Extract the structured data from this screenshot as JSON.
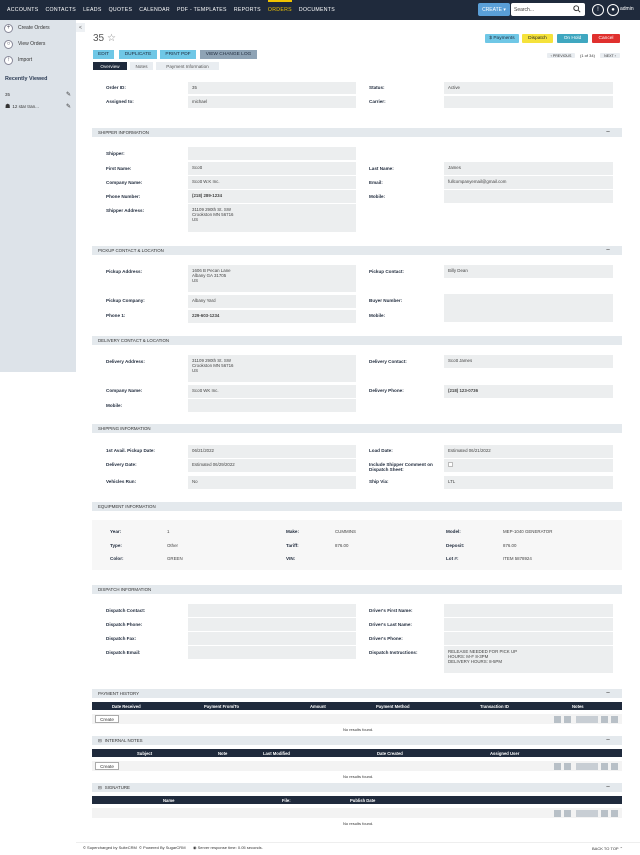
{
  "nav": {
    "items": [
      "ACCOUNTS",
      "CONTACTS",
      "LEADS",
      "QUOTES",
      "CALENDAR",
      "PDF - TEMPLATES",
      "REPORTS",
      "ORDERS",
      "DOCUMENTS"
    ],
    "create_label": "CREATE",
    "search_placeholder": "Search...",
    "user_label": "admin"
  },
  "sidebar": {
    "actions": [
      "Create Orders",
      "View Orders",
      "Import"
    ],
    "recently_viewed_title": "Recently Viewed",
    "recent_items": [
      "35",
      "12 star tran..."
    ]
  },
  "record": {
    "title": "35",
    "buttons": [
      "EDIT",
      "DUPLICATE",
      "PRINT PDF",
      "VIEW CHANGE LOG"
    ],
    "tabs": [
      "Overview",
      "Notes",
      "Payment Information"
    ],
    "status_buttons": [
      "$ Payments",
      "Dispatch",
      "On Hold",
      "Cancel"
    ],
    "pager": {
      "previous": "PREVIOUS",
      "count": "(1 of 34)",
      "next": "NEXT"
    }
  },
  "overview": {
    "order_id_label": "Order ID:",
    "order_id": "35",
    "status_label": "Status:",
    "status": "Active",
    "assigned_label": "Assigned to:",
    "assigned": "michael",
    "carrier_label": "Carrier:",
    "carrier": ""
  },
  "shipper": {
    "header": "SHIPPER INFORMATION",
    "shipper_label": "Shipper:",
    "first_name_label": "First Name:",
    "first_name": "Scott",
    "last_name_label": "Last Name:",
    "last_name": "James",
    "company_label": "Company Name:",
    "company": "Scott W.K Inc.",
    "email_label": "Email:",
    "email": "fullcompanyemail@gmail.com",
    "phone_label": "Phone Number:",
    "phone": "(218) 289-1234",
    "mobile_label": "Mobile:",
    "address_label": "Shipper Address:",
    "address": [
      "31109 290th St. SW",
      "Crookston MN  56716",
      "US"
    ]
  },
  "pickup": {
    "header": "PICKUP CONTACT & LOCATION",
    "address_label": "Pickup Address:",
    "address": [
      "1606 B Pecan Lane",
      "Albany GA  31705",
      "US"
    ],
    "contact_label": "Pickup Contact:",
    "contact": "Billy Dean",
    "company_label": "Pickup Company:",
    "company": "Albany Yard",
    "buyer_label": "Buyer Number:",
    "phone_label": "Phone 1:",
    "phone": "229-603-1234",
    "mobile_label": "Mobile:"
  },
  "delivery": {
    "header": "DELIVERY CONTACT & LOCATION",
    "address_label": "Delivery Address:",
    "address": [
      "31109 290th St. SW",
      "Crookston MN  56716",
      "US"
    ],
    "contact_label": "Delivery Contact:",
    "contact": "Scott James",
    "company_label": "Company Name:",
    "company": "Scott WK Inc.",
    "phone_label": "Delivery Phone:",
    "phone": "(218) 123-0736",
    "mobile_label": "Mobile:"
  },
  "shipping": {
    "header": "SHIPPING INFORMATION",
    "pickup_label": "1st Avail. Pickup Date:",
    "pickup": "06/21/2022",
    "load_label": "Load Date:",
    "load": "Estimated 06/21/2022",
    "delivery_label": "Delivery Date:",
    "delivery": "Estimated 06/29/2022",
    "include_label": "Include Shipper Comment on Dispatch Sheet:",
    "vehicles_label": "Vehicles Run:",
    "vehicles": "No",
    "shipvia_label": "Ship Via:",
    "shipvia": "LTL"
  },
  "equipment": {
    "header": "EQUIPMENT INFORMATION",
    "year_label": "Year:",
    "year": "1",
    "make_label": "Make:",
    "make": "CUMMINS",
    "model_label": "Model:",
    "model": "MEP-1040 GENERATOR",
    "type_label": "Type:",
    "type": "Other",
    "tariff_label": "Tariff:",
    "tariff": "876.00",
    "deposit_label": "Deposit:",
    "deposit": "876.00",
    "color_label": "Color:",
    "color": "GREEN",
    "vin_label": "VIN:",
    "vin": "",
    "lot_label": "Lot #:",
    "lot": "ITEM 5878924"
  },
  "dispatch": {
    "header": "DISPATCH INFORMATION",
    "contact_label": "Dispatch Contact:",
    "driver_first_label": "Driver's First Name:",
    "phone_label": "Dispatch Phone:",
    "driver_last_label": "Driver's Last Name:",
    "fax_label": "Dispatch Fax:",
    "driver_phone_label": "Driver's Phone:",
    "email_label": "Dispatch Email:",
    "instructions_label": "Dispatch Instructions:",
    "instructions": [
      "RELEASE NEEDED FOR PICK UP",
      "HOURS: M-F 8-3PM",
      "DELIVERY HOURS: 8-5PM"
    ]
  },
  "payment_history": {
    "header": "PAYMENT HISTORY",
    "columns": [
      "Date Received",
      "Payment From/To",
      "Amount",
      "Payment Method",
      "Transaction ID",
      "Notes"
    ],
    "create": "Create",
    "no_results": "No results found."
  },
  "internal_notes": {
    "header": "INTERNAL NOTES",
    "columns": [
      "Subject",
      "Note",
      "Last Modified",
      "Date Created",
      "Assigned User"
    ],
    "create": "Create",
    "no_results": "No results found."
  },
  "signature": {
    "header": "SIGNATURE",
    "columns": [
      "Name",
      "File:",
      "Publish Date"
    ],
    "no_results": "No results found."
  },
  "footer": {
    "left1": "© Supercharged by SuiteCRM",
    "left2": "© Powered By SugarCRM",
    "server": "Server response time: 0.05 seconds.",
    "back_to_top": "BACK TO TOP"
  },
  "colors": {
    "navbar": "#1f2a3c",
    "accent": "#f0c400",
    "action_button": "#6fc7e6",
    "dispatch": "#f5e23b",
    "onhold": "#3fa7c0",
    "cancel": "#e0302e"
  }
}
